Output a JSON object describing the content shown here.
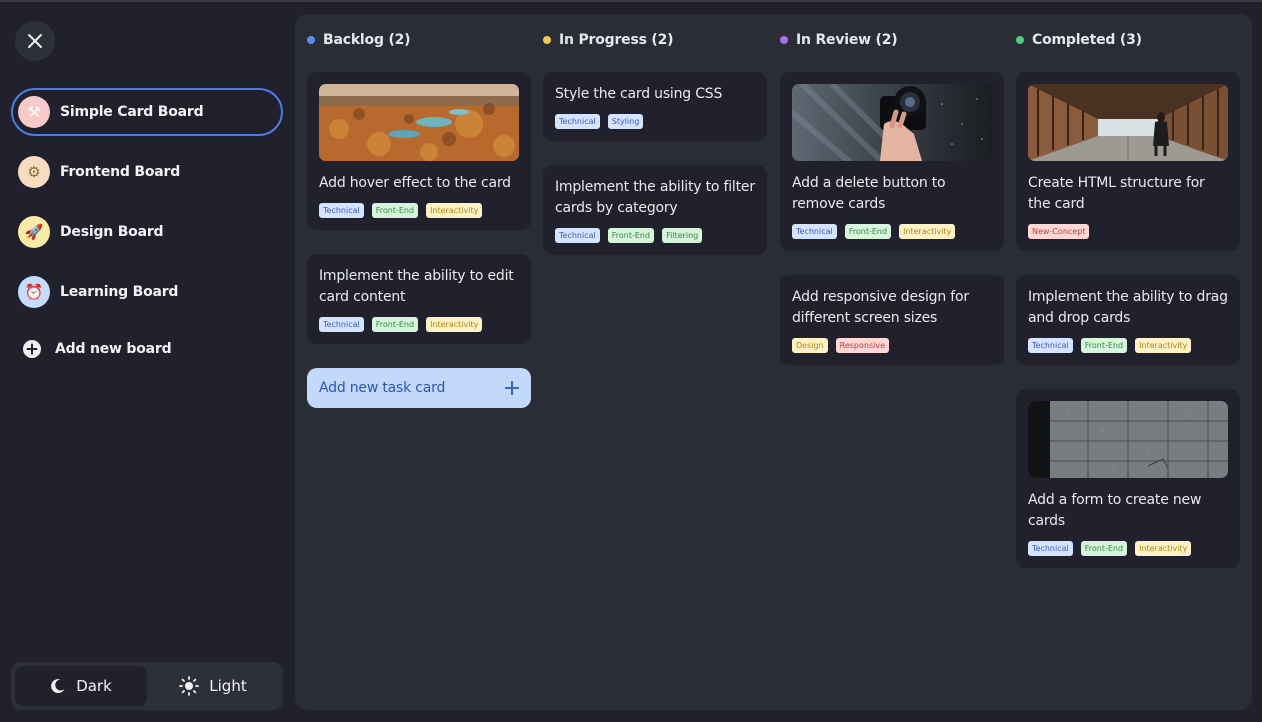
{
  "sidebar": {
    "boards": [
      {
        "label": "Simple Card Board",
        "icon": "tools-icon",
        "glyph": "⚒",
        "bg": "#f8c9c9",
        "active": true
      },
      {
        "label": "Frontend Board",
        "icon": "gear-icon",
        "glyph": "⚙",
        "bg": "#f8dcc0",
        "active": false
      },
      {
        "label": "Design Board",
        "icon": "rocket-icon",
        "glyph": "🚀",
        "bg": "#fbeaa6",
        "active": false
      },
      {
        "label": "Learning Board",
        "icon": "alarm-clock-icon",
        "glyph": "⏰",
        "bg": "#c6dcfb",
        "active": false
      }
    ],
    "add_board_label": "Add new board",
    "theme": {
      "dark_label": "Dark",
      "light_label": "Light",
      "selected": "Dark"
    }
  },
  "columns": [
    {
      "title": "Backlog (2)",
      "dot_color": "#5b8def",
      "cards": [
        {
          "title": "Add hover effect to the card",
          "image": "autumn-landscape",
          "tags": [
            "Technical",
            "Front-End",
            "Interactivity"
          ]
        },
        {
          "title": "Implement the ability to edit card content",
          "tags": [
            "Technical",
            "Front-End",
            "Interactivity"
          ]
        }
      ],
      "add_task_label": "Add new task card"
    },
    {
      "title": "In Progress (2)",
      "dot_color": "#f2c94c",
      "cards": [
        {
          "title": "Style the card using CSS",
          "tags": [
            "Technical",
            "Styling"
          ]
        },
        {
          "title": "Implement the ability to filter cards by category",
          "tags": [
            "Technical",
            "Front-End",
            "Filtering"
          ]
        }
      ]
    },
    {
      "title": "In Review (2)",
      "dot_color": "#a374f0",
      "cards": [
        {
          "title": "Add a delete button to remove cards",
          "image": "camera-hand",
          "tags": [
            "Technical",
            "Front-End",
            "Interactivity"
          ]
        },
        {
          "title": "Add responsive design for different screen sizes",
          "tags": [
            "Design",
            "Responsive"
          ]
        }
      ]
    },
    {
      "title": "Completed (3)",
      "dot_color": "#4cd07d",
      "cards": [
        {
          "title": "Create HTML structure for the card",
          "image": "covered-bridge",
          "tags": [
            "New-Concept"
          ]
        },
        {
          "title": "Implement the ability to drag and drop cards",
          "tags": [
            "Technical",
            "Front-End",
            "Interactivity"
          ]
        },
        {
          "title": "Add a form to create new cards",
          "image": "concrete-wall",
          "tags": [
            "Technical",
            "Front-End",
            "Interactivity"
          ]
        }
      ]
    }
  ]
}
